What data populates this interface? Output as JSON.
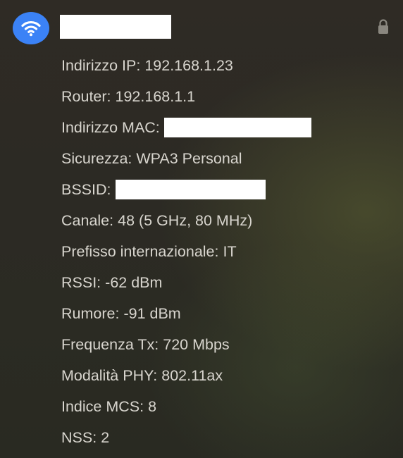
{
  "header": {
    "wifi_icon": "wifi-icon",
    "network_name": "",
    "lock_icon": "lock-icon",
    "accent_color": "#3b82f6"
  },
  "details": [
    {
      "label": "Indirizzo IP:",
      "value": "192.168.1.23"
    },
    {
      "label": "Router:",
      "value": "192.168.1.1"
    },
    {
      "label": "Indirizzo MAC:",
      "value": ""
    },
    {
      "label": "Sicurezza:",
      "value": "WPA3 Personal"
    },
    {
      "label": "BSSID:",
      "value": ""
    },
    {
      "label": "Canale:",
      "value": "48 (5 GHz, 80 MHz)"
    },
    {
      "label": "Prefisso internazionale:",
      "value": "IT"
    },
    {
      "label": "RSSI:",
      "value": "-62 dBm"
    },
    {
      "label": "Rumore:",
      "value": "-91 dBm"
    },
    {
      "label": "Frequenza Tx:",
      "value": "720 Mbps"
    },
    {
      "label": "Modalità PHY:",
      "value": "802.11ax"
    },
    {
      "label": "Indice MCS:",
      "value": "8"
    },
    {
      "label": "NSS:",
      "value": "2"
    }
  ]
}
